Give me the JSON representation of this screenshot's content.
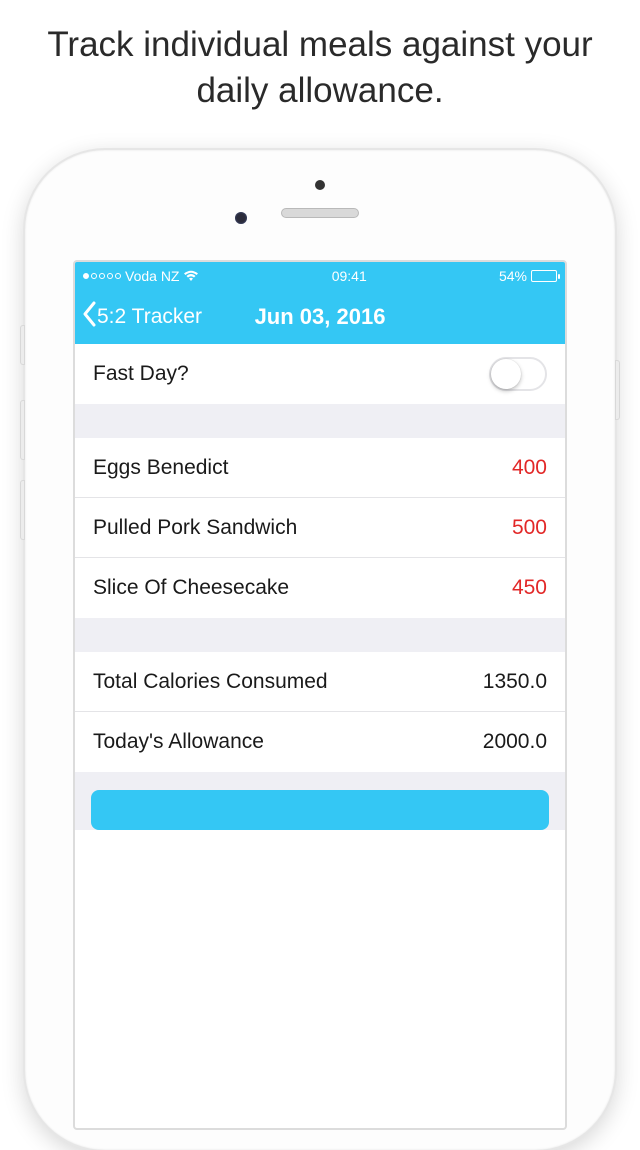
{
  "headline": "Track individual meals against your daily allowance.",
  "statusbar": {
    "carrier": "Voda NZ",
    "time": "09:41",
    "battery_pct": "54%"
  },
  "navbar": {
    "back_label": "5:2 Tracker",
    "title": "Jun 03, 2016"
  },
  "fastday": {
    "label": "Fast Day?",
    "value": false
  },
  "meals": [
    {
      "name": "Eggs Benedict",
      "calories": "400"
    },
    {
      "name": "Pulled Pork Sandwich",
      "calories": "500"
    },
    {
      "name": "Slice Of Cheesecake",
      "calories": "450"
    }
  ],
  "summary": [
    {
      "label": "Total Calories Consumed",
      "value": "1350.0"
    },
    {
      "label": "Today's Allowance",
      "value": "2000.0"
    }
  ]
}
